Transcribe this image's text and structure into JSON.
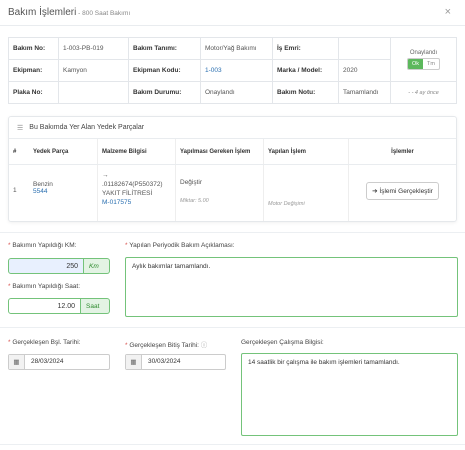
{
  "header": {
    "title": "Bakım İşlemleri",
    "dash": " - ",
    "subtitle": "800 Saat Bakımı",
    "close": "×"
  },
  "info": {
    "bakim_no_label": "Bakım No:",
    "bakim_no": "1-003-PB-019",
    "bakim_tanimi_label": "Bakım Tanımı:",
    "bakim_tanimi": "Motor/Yağ Bakımı",
    "is_emri_label": "İş Emri:",
    "is_emri": "",
    "onay_label": "Onaylandı",
    "toggle_ok": "Ok",
    "toggle_tm": "Tm",
    "ekipman_label": "Ekipman:",
    "ekipman": "Kamyon",
    "ekipman_kodu_label": "Ekipman Kodu:",
    "ekipman_kodu": "1-003",
    "marka_label": "Marka / Model:",
    "marka": "2020",
    "plaka_label": "Plaka No:",
    "plaka": "",
    "bakim_durumu_label": "Bakım Durumu:",
    "bakim_durumu": "Onaylandı",
    "bakim_notu_label": "Bakım Notu:",
    "bakim_notu": "Tamamlandı",
    "ago": "- - 4 ay önce"
  },
  "parts": {
    "title": "Bu Bakımda Yer Alan Yedek Parçalar",
    "headers": [
      "#",
      "Yedek Parça",
      "Malzeme Bilgisi",
      "Yapılması Gereken İşlem",
      "Yapılan İşlem",
      "İşlemler"
    ],
    "row": {
      "no": "1",
      "part": "Benzin",
      "part_code": "5544",
      "arrow": "→",
      "mat_code": ".01182674(P550372)",
      "mat_name": "YAKIT FİLİTRESİ",
      "mat_ref": "M-017575",
      "required": "Değiştir",
      "qty": "Miktar: 5.00",
      "done": "Motor Değişimi",
      "action": "İşlemi Gerçekleştir",
      "action_arrow": "➔"
    }
  },
  "form": {
    "km_label": "Bakımın Yapıldığı KM:",
    "km_value": "250",
    "km_unit": "Km",
    "saat_label": "Bakımın Yapıldığı Saat:",
    "saat_value": "12.00",
    "saat_unit": "Saat",
    "aciklama_label": "Yapılan Periyodik Bakım Açıklaması:",
    "aciklama": "Aylık bakımlar tamamlandı.",
    "bsl_label": "Gerçekleşen Bşl. Tarihi:",
    "bsl_value": "28/03/2024",
    "bitis_label": "Gerçekleşen Bitiş Tarihi:",
    "bitis_info": "ⓘ",
    "bitis_value": "30/03/2024",
    "calisma_label": "Gerçekleşen Çalışma Bilgisi:",
    "calisma": "14 saatlik bir çalışma ile bakım işlemleri tamamlandı.",
    "req": "*"
  }
}
